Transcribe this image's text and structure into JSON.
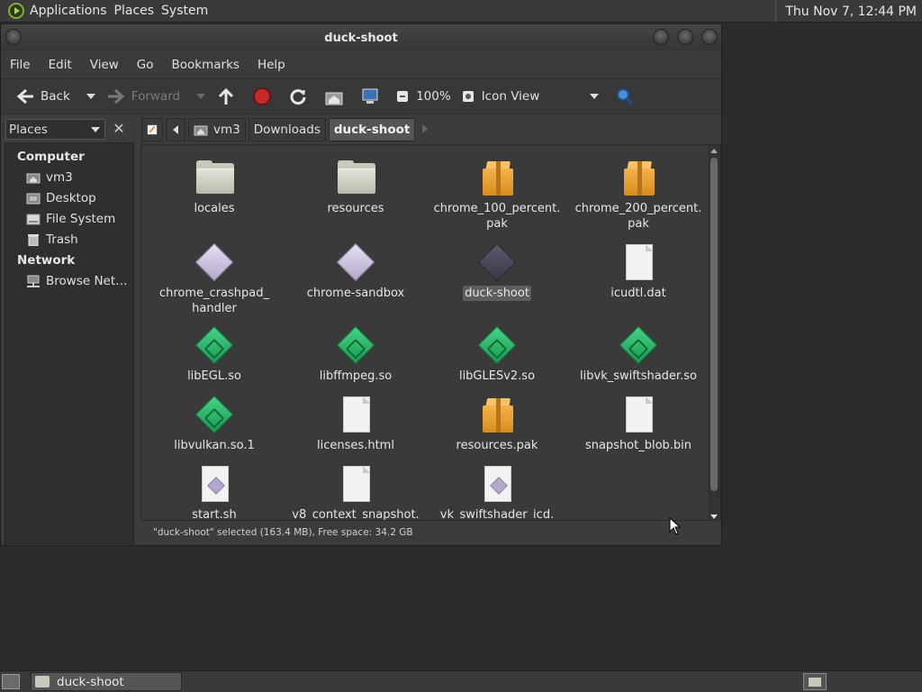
{
  "top_panel": {
    "menus": [
      "Applications",
      "Places",
      "System"
    ],
    "clock": "Thu Nov  7, 12:44 PM"
  },
  "window": {
    "title": "duck-shoot",
    "menubar": [
      "File",
      "Edit",
      "View",
      "Go",
      "Bookmarks",
      "Help"
    ],
    "toolbar": {
      "back": "Back",
      "forward": "Forward",
      "zoom": "100%",
      "view_mode": "Icon View"
    },
    "sidebar_selector": "Places",
    "breadcrumbs": [
      "vm3",
      "Downloads",
      "duck-shoot"
    ],
    "sidebar": {
      "computer_heading": "Computer",
      "computer_items": [
        "vm3",
        "Desktop",
        "File System",
        "Trash"
      ],
      "network_heading": "Network",
      "network_items": [
        "Browse Net…"
      ]
    },
    "files": [
      {
        "name": "locales",
        "type": "folder"
      },
      {
        "name": "resources",
        "type": "folder"
      },
      {
        "name": "chrome_100_percent.\npak",
        "type": "package"
      },
      {
        "name": "chrome_200_percent.\npak",
        "type": "package"
      },
      {
        "name": "chrome_crashpad_\nhandler",
        "type": "executable"
      },
      {
        "name": "chrome-sandbox",
        "type": "executable"
      },
      {
        "name": "duck-shoot",
        "type": "executable-selected"
      },
      {
        "name": "icudtl.dat",
        "type": "document"
      },
      {
        "name": "libEGL.so",
        "type": "library"
      },
      {
        "name": "libffmpeg.so",
        "type": "library"
      },
      {
        "name": "libGLESv2.so",
        "type": "library"
      },
      {
        "name": "libvk_swiftshader.so",
        "type": "library"
      },
      {
        "name": "libvulkan.so.1",
        "type": "library"
      },
      {
        "name": "licenses.html",
        "type": "document"
      },
      {
        "name": "resources.pak",
        "type": "package"
      },
      {
        "name": "snapshot_blob.bin",
        "type": "document"
      },
      {
        "name": "start.sh",
        "type": "script"
      },
      {
        "name": "v8_context_snapshot.",
        "type": "document"
      },
      {
        "name": "vk_swiftshader_icd.",
        "type": "script"
      }
    ],
    "status": "\"duck-shoot\" selected (163.4 MB), Free space: 34.2 GB"
  },
  "bottom_panel": {
    "task": "duck-shoot"
  }
}
